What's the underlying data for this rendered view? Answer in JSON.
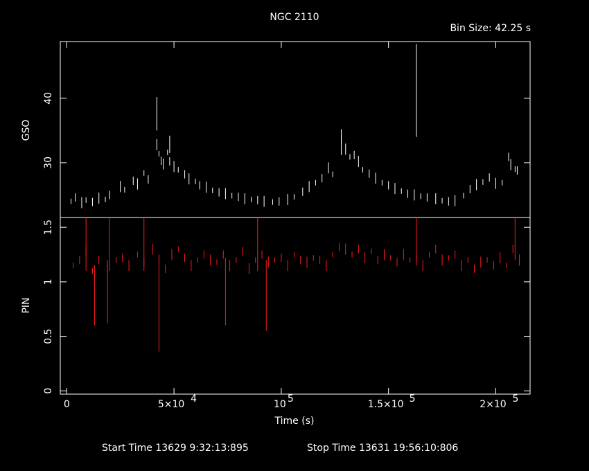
{
  "title": "NGC 2110",
  "bin_size": "Bin Size: 42.25 s",
  "footer": {
    "start": "Start Time 13629  9:32:13:895",
    "stop": "Stop Time 13631 19:56:10:806"
  },
  "colors": {
    "background": "#000000",
    "axes": "#ffffff",
    "gso": "#ffffff",
    "pin": "#ff1a1a"
  },
  "chart_data": [
    {
      "type": "scatter",
      "panel": "top",
      "ylabel": "GSO",
      "xlim": [
        -3000,
        216000
      ],
      "ylim": [
        21.5,
        48.8
      ],
      "ytick_labels": [
        "30",
        "40"
      ],
      "yticks": [
        30,
        40
      ],
      "series": [
        {
          "points": [
            [
              2000,
              24.0
            ],
            [
              4000,
              24.6
            ],
            [
              7000,
              23.8
            ],
            [
              9000,
              24.2
            ],
            [
              12000,
              23.9
            ],
            [
              15000,
              24.5
            ],
            [
              18000,
              24.3
            ],
            [
              20000,
              25.0
            ],
            [
              25000,
              26.3
            ],
            [
              27000,
              25.8
            ],
            [
              31000,
              27.2
            ],
            [
              33000,
              26.7
            ],
            [
              36000,
              28.4
            ],
            [
              38000,
              27.4
            ],
            [
              42000,
              32.8
            ],
            [
              43000,
              31.4
            ],
            [
              44000,
              30.3
            ],
            [
              45000,
              29.8
            ],
            [
              47000,
              31.6
            ],
            [
              48000,
              30.2
            ],
            [
              50000,
              29.4
            ],
            [
              52000,
              28.9
            ],
            [
              55000,
              28.2
            ],
            [
              57000,
              27.5
            ],
            [
              60000,
              27.1
            ],
            [
              62000,
              26.5
            ],
            [
              65000,
              26.2
            ],
            [
              68000,
              25.7
            ],
            [
              71000,
              25.4
            ],
            [
              74000,
              25.2
            ],
            [
              77000,
              24.9
            ],
            [
              80000,
              24.7
            ],
            [
              83000,
              24.4
            ],
            [
              86000,
              24.3
            ],
            [
              89000,
              24.2
            ],
            [
              92000,
              24.0
            ],
            [
              96000,
              23.9
            ],
            [
              99000,
              24.0
            ],
            [
              103000,
              24.3
            ],
            [
              106000,
              24.7
            ],
            [
              110000,
              25.5
            ],
            [
              113000,
              26.3
            ],
            [
              116000,
              26.9
            ],
            [
              119000,
              27.6
            ],
            [
              122000,
              29.2
            ],
            [
              124000,
              28.2
            ],
            [
              128000,
              33.6
            ],
            [
              130000,
              32.1
            ],
            [
              132000,
              30.9
            ],
            [
              134000,
              31.2
            ],
            [
              136000,
              30.2
            ],
            [
              138000,
              28.9
            ],
            [
              141000,
              28.3
            ],
            [
              144000,
              27.6
            ],
            [
              147000,
              26.9
            ],
            [
              150000,
              26.5
            ],
            [
              153000,
              26.0
            ],
            [
              156000,
              25.6
            ],
            [
              159000,
              25.2
            ],
            [
              162000,
              25.0
            ],
            [
              165000,
              24.8
            ],
            [
              168000,
              24.6
            ],
            [
              172000,
              24.4
            ],
            [
              175000,
              24.1
            ],
            [
              178000,
              24.0
            ],
            [
              181000,
              24.1
            ],
            [
              185000,
              24.9
            ],
            [
              188000,
              25.9
            ],
            [
              191000,
              26.6
            ],
            [
              194000,
              27.0
            ],
            [
              197000,
              27.7
            ],
            [
              200000,
              26.8
            ],
            [
              203000,
              26.9
            ],
            [
              206000,
              30.9
            ],
            [
              207000,
              29.7
            ],
            [
              209000,
              29.0
            ],
            [
              210000,
              28.8
            ]
          ],
          "spikes": [
            [
              42000,
              35.0,
              40.2
            ],
            [
              48000,
              31.5,
              34.2
            ],
            [
              128000,
              31.2,
              35.2
            ],
            [
              163000,
              34.0,
              48.4
            ]
          ]
        }
      ]
    },
    {
      "type": "scatter",
      "panel": "bottom",
      "ylabel": "PIN",
      "xlabel": "Time (s)",
      "xlim": [
        -3000,
        216000
      ],
      "ylim": [
        -0.03,
        1.59
      ],
      "ytick_labels": [
        "0",
        "0.5",
        "1",
        "1.5"
      ],
      "yticks": [
        0,
        0.5,
        1,
        1.5
      ],
      "xtick_labels": [
        "0",
        "5×10",
        "4",
        "10",
        "5",
        "1.5×10",
        "5",
        "2×10",
        "5"
      ],
      "xticks": [
        0,
        50000,
        100000,
        150000,
        200000
      ],
      "series": [
        {
          "points": [
            [
              3000,
              1.15
            ],
            [
              6000,
              1.2
            ],
            [
              9000,
              1.28
            ],
            [
              12000,
              1.1
            ],
            [
              15000,
              1.2
            ],
            [
              19000,
              1.12
            ],
            [
              23000,
              1.2
            ],
            [
              26000,
              1.22
            ],
            [
              29000,
              1.15
            ],
            [
              33000,
              1.25
            ],
            [
              36000,
              1.18
            ],
            [
              40000,
              1.3
            ],
            [
              43000,
              1.2
            ],
            [
              46000,
              1.12
            ],
            [
              49000,
              1.25
            ],
            [
              52000,
              1.3
            ],
            [
              55000,
              1.22
            ],
            [
              58000,
              1.15
            ],
            [
              61000,
              1.2
            ],
            [
              64000,
              1.25
            ],
            [
              67000,
              1.2
            ],
            [
              70000,
              1.18
            ],
            [
              73000,
              1.25
            ],
            [
              76000,
              1.15
            ],
            [
              79000,
              1.2
            ],
            [
              82000,
              1.28
            ],
            [
              85000,
              1.12
            ],
            [
              88000,
              1.2
            ],
            [
              91000,
              1.25
            ],
            [
              94000,
              1.18
            ],
            [
              97000,
              1.2
            ],
            [
              100000,
              1.22
            ],
            [
              103000,
              1.15
            ],
            [
              106000,
              1.25
            ],
            [
              109000,
              1.2
            ],
            [
              112000,
              1.18
            ],
            [
              115000,
              1.22
            ],
            [
              118000,
              1.2
            ],
            [
              121000,
              1.15
            ],
            [
              124000,
              1.25
            ],
            [
              127000,
              1.32
            ],
            [
              130000,
              1.3
            ],
            [
              133000,
              1.25
            ],
            [
              136000,
              1.3
            ],
            [
              139000,
              1.22
            ],
            [
              142000,
              1.28
            ],
            [
              145000,
              1.2
            ],
            [
              148000,
              1.25
            ],
            [
              151000,
              1.22
            ],
            [
              154000,
              1.18
            ],
            [
              157000,
              1.25
            ],
            [
              160000,
              1.2
            ],
            [
              163000,
              1.22
            ],
            [
              166000,
              1.15
            ],
            [
              169000,
              1.25
            ],
            [
              172000,
              1.3
            ],
            [
              175000,
              1.2
            ],
            [
              178000,
              1.22
            ],
            [
              181000,
              1.25
            ],
            [
              184000,
              1.15
            ],
            [
              187000,
              1.2
            ],
            [
              190000,
              1.12
            ],
            [
              193000,
              1.18
            ],
            [
              196000,
              1.2
            ],
            [
              199000,
              1.15
            ],
            [
              202000,
              1.22
            ],
            [
              205000,
              1.15
            ],
            [
              208000,
              1.3
            ],
            [
              211000,
              1.2
            ]
          ],
          "spikes": [
            [
              13000,
              0.6,
              1.15
            ],
            [
              19000,
              0.62,
              1.2
            ],
            [
              43000,
              0.36,
              1.25
            ],
            [
              74000,
              0.6,
              1.22
            ],
            [
              93000,
              0.55,
              1.2
            ],
            [
              9000,
              1.1,
              1.59
            ],
            [
              20000,
              1.1,
              1.59
            ],
            [
              36000,
              1.1,
              1.59
            ],
            [
              89000,
              1.1,
              1.59
            ],
            [
              163000,
              1.15,
              1.59
            ],
            [
              209000,
              1.2,
              1.59
            ]
          ]
        }
      ]
    }
  ]
}
